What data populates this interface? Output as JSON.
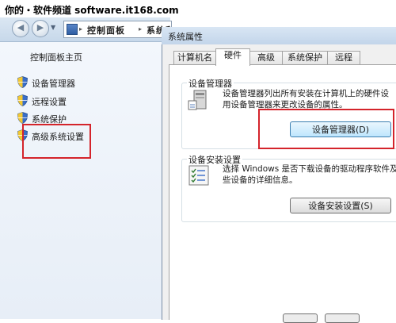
{
  "watermark": {
    "text": "你的・软件频道 software.it168.com"
  },
  "explorer": {
    "back_icon": "back-arrow-icon",
    "forward_icon": "forward-arrow-icon",
    "address": {
      "sep": "▸",
      "part1": "控制面板",
      "part2": "系统和安全"
    }
  },
  "left_nav": {
    "home": "控制面板主页",
    "items": [
      {
        "label": "设备管理器",
        "icon": "shield-icon"
      },
      {
        "label": "远程设置",
        "icon": "shield-icon"
      },
      {
        "label": "系统保护",
        "icon": "shield-icon"
      },
      {
        "label": "高级系统设置",
        "icon": "shield-icon"
      }
    ]
  },
  "dialog": {
    "title": "系统属性",
    "tabs": [
      "计算机名",
      "硬件",
      "高级",
      "系统保护",
      "远程"
    ],
    "active_tab": "硬件",
    "device_manager": {
      "group_title": "设备管理器",
      "desc_line1": "设备管理器列出所有安装在计算机上的硬件设",
      "desc_line2": "用设备管理器来更改设备的属性。",
      "button": "设备管理器(D)"
    },
    "device_install": {
      "group_title": "设备安装设置",
      "desc_line1": "选择 Windows 是否下载设备的驱动程序软件及",
      "desc_line2": "些设备的详细信息。",
      "button": "设备安装设置(S)"
    }
  },
  "colors": {
    "highlight": "#d4242b",
    "accent": "#3c7fb1"
  }
}
